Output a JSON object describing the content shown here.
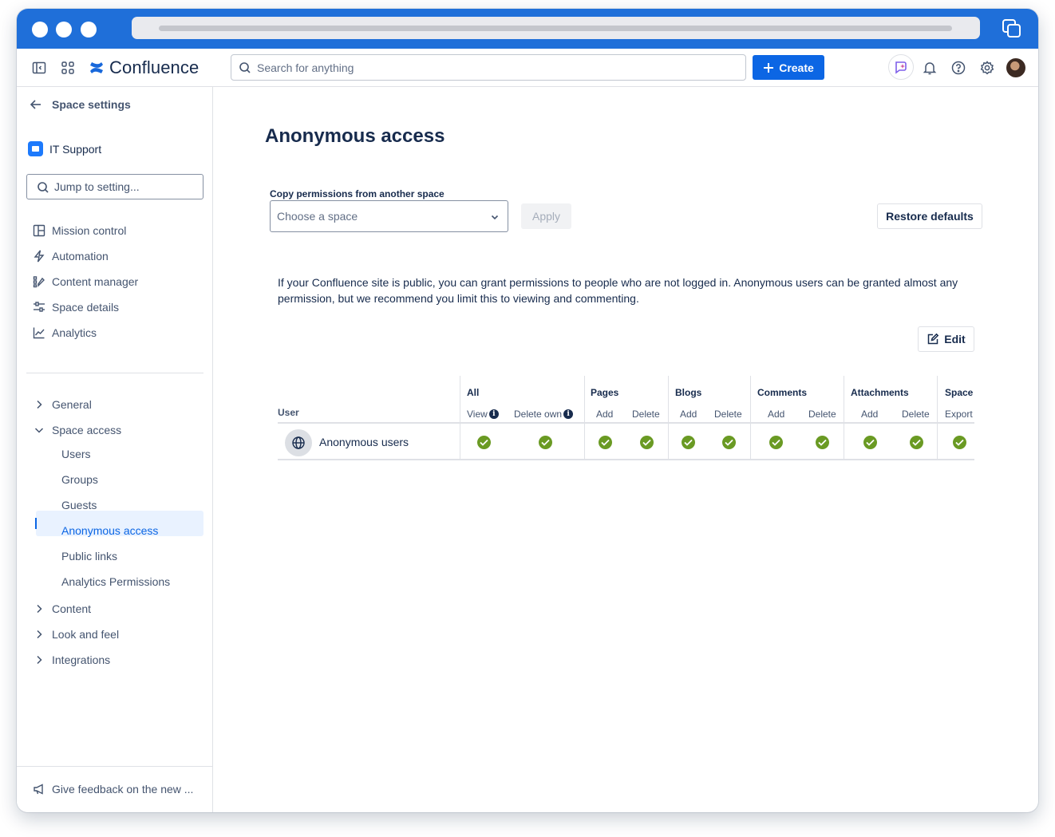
{
  "app": {
    "name": "Confluence"
  },
  "topnav": {
    "search_placeholder": "Search for anything",
    "create_label": "Create",
    "accent": "#0C66E4"
  },
  "sidebar": {
    "back_label": "Space settings",
    "space_name": "IT Support",
    "jump_placeholder": "Jump to setting...",
    "items": [
      {
        "label": "Mission control",
        "icon": "layout-icon"
      },
      {
        "label": "Automation",
        "icon": "lightning-icon"
      },
      {
        "label": "Content manager",
        "icon": "content-manager-icon"
      },
      {
        "label": "Space details",
        "icon": "sliders-icon"
      },
      {
        "label": "Analytics",
        "icon": "chart-line-icon"
      }
    ],
    "sections": [
      {
        "label": "General",
        "expanded": false
      },
      {
        "label": "Space access",
        "expanded": true
      },
      {
        "label": "Content",
        "expanded": false
      },
      {
        "label": "Look and feel",
        "expanded": false
      },
      {
        "label": "Integrations",
        "expanded": false
      }
    ],
    "space_access_children": [
      "Users",
      "Groups",
      "Guests",
      "Anonymous access",
      "Public links",
      "Analytics Permissions"
    ],
    "active_item": "Anonymous access",
    "feedback_label": "Give feedback on the new ..."
  },
  "main": {
    "title": "Anonymous access",
    "copy_label": "Copy permissions from another space",
    "select_placeholder": "Choose a space",
    "apply_label": "Apply",
    "restore_label": "Restore defaults",
    "description": "If your Confluence site is public, you can grant permissions to people who are not logged in. Anonymous users can be granted almost any permission, but we recommend you limit this to viewing and commenting.",
    "edit_label": "Edit"
  },
  "table": {
    "user_header": "User",
    "groups": [
      "All",
      "Pages",
      "Blogs",
      "Comments",
      "Attachments",
      "Space"
    ],
    "columns": [
      "View",
      "Delete own",
      "Add",
      "Delete",
      "Add",
      "Delete",
      "Add",
      "Delete",
      "Add",
      "Delete",
      "Export"
    ],
    "rows": [
      {
        "user": "Anonymous users",
        "permissions": [
          true,
          true,
          true,
          true,
          true,
          true,
          true,
          true,
          true,
          true,
          true
        ]
      }
    ],
    "check_color": "#6A9A23"
  }
}
